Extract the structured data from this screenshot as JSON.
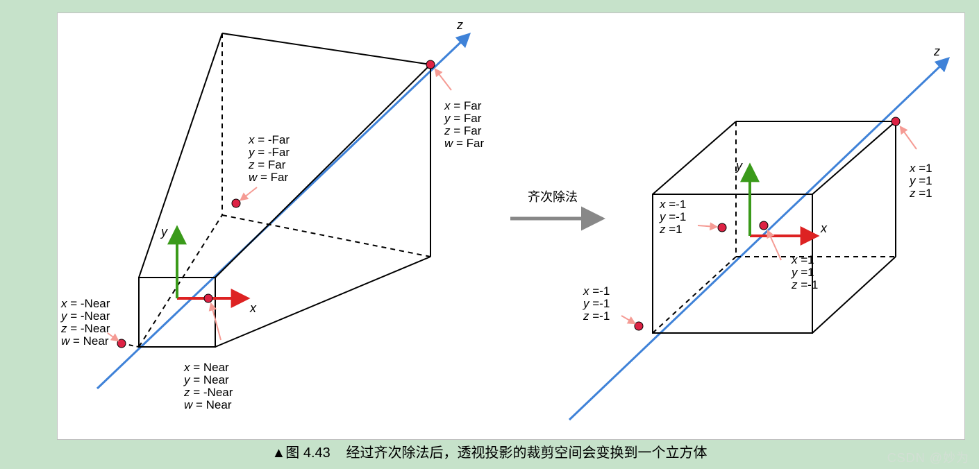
{
  "caption_prefix": "▲图 4.43",
  "caption_text": "经过齐次除法后，透视投影的裁剪空间会变换到一个立方体",
  "middle_label": "齐次除法",
  "watermark": "CSDN @妙为",
  "axes": {
    "x": "x",
    "y": "y",
    "z": "z"
  },
  "left_points": {
    "near_neg": [
      {
        "var": "x",
        "val": "-Near"
      },
      {
        "var": "y",
        "val": "-Near"
      },
      {
        "var": "z",
        "val": "-Near"
      },
      {
        "var": "w",
        "val": "Near"
      }
    ],
    "near_pos": [
      {
        "var": "x",
        "val": "Near"
      },
      {
        "var": "y",
        "val": "Near"
      },
      {
        "var": "z",
        "val": "-Near"
      },
      {
        "var": "w",
        "val": "Near"
      }
    ],
    "far_neg": [
      {
        "var": "x",
        "val": "-Far"
      },
      {
        "var": "y",
        "val": "-Far"
      },
      {
        "var": "z",
        "val": "Far"
      },
      {
        "var": "w",
        "val": "Far"
      }
    ],
    "far_pos": [
      {
        "var": "x",
        "val": "Far"
      },
      {
        "var": "y",
        "val": "Far"
      },
      {
        "var": "z",
        "val": "Far"
      },
      {
        "var": "w",
        "val": "Far"
      }
    ]
  },
  "right_points": {
    "near_neg": [
      {
        "var": "x",
        "val": "-1"
      },
      {
        "var": "y",
        "val": "-1"
      },
      {
        "var": "z",
        "val": "-1"
      }
    ],
    "near_pos": [
      {
        "var": "x",
        "val": "1"
      },
      {
        "var": "y",
        "val": "1"
      },
      {
        "var": "z",
        "val": "-1"
      }
    ],
    "far_neg": [
      {
        "var": "x",
        "val": "-1"
      },
      {
        "var": "y",
        "val": "-1"
      },
      {
        "var": "z",
        "val": "1"
      }
    ],
    "far_pos": [
      {
        "var": "x",
        "val": "1"
      },
      {
        "var": "y",
        "val": "1"
      },
      {
        "var": "z",
        "val": "1"
      }
    ]
  }
}
